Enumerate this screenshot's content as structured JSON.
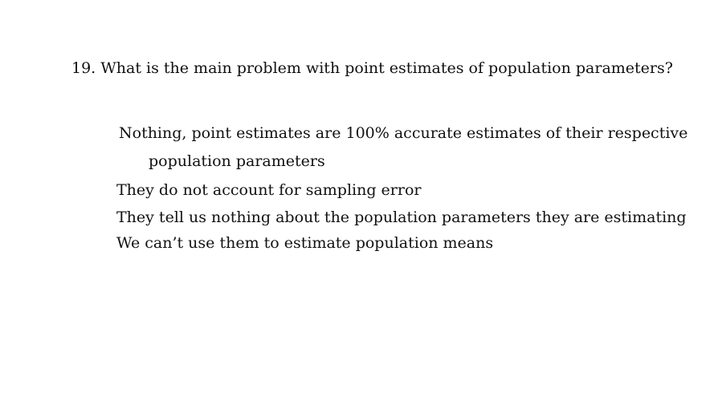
{
  "question": {
    "text": "19. What is the main problem with point estimates of population parameters?"
  },
  "options": [
    {
      "line1": "Nothing, point estimates are 100% accurate estimates of their respective",
      "line2": "population parameters"
    },
    {
      "text": "They do not account for sampling error"
    },
    {
      "text": "They tell us nothing about the population parameters they are estimating"
    },
    {
      "text": "We can’t use them to estimate population means"
    }
  ]
}
